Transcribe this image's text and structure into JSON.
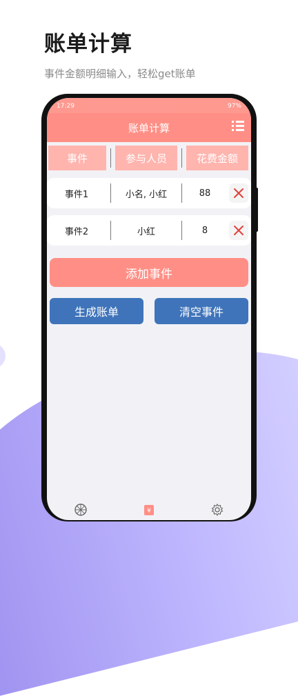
{
  "promo": {
    "title": "账单计算",
    "subtitle": "事件金额明细输入，轻松get账单"
  },
  "status": {
    "time": "17:29",
    "battery": "97%"
  },
  "app": {
    "title": "账单计算",
    "menu_icon": "list-menu-icon"
  },
  "table": {
    "headers": [
      "事件",
      "参与人员",
      "花费金额"
    ],
    "rows": [
      {
        "event": "事件1",
        "people": "小名, 小红",
        "amount": "88"
      },
      {
        "event": "事件2",
        "people": "小红",
        "amount": "8"
      }
    ]
  },
  "buttons": {
    "add_event": "添加事件",
    "generate_bill": "生成账单",
    "clear_events": "清空事件"
  },
  "bottom_nav": {
    "icons": [
      "wheel-icon",
      "yen-bill-icon",
      "settings-gear-icon"
    ],
    "active_color": "#ff8f86"
  },
  "colors": {
    "accent": "#ff8f86",
    "header_cell": "#ffb4ae",
    "blue": "#3f74ba",
    "delete_x": "#e0413a"
  }
}
